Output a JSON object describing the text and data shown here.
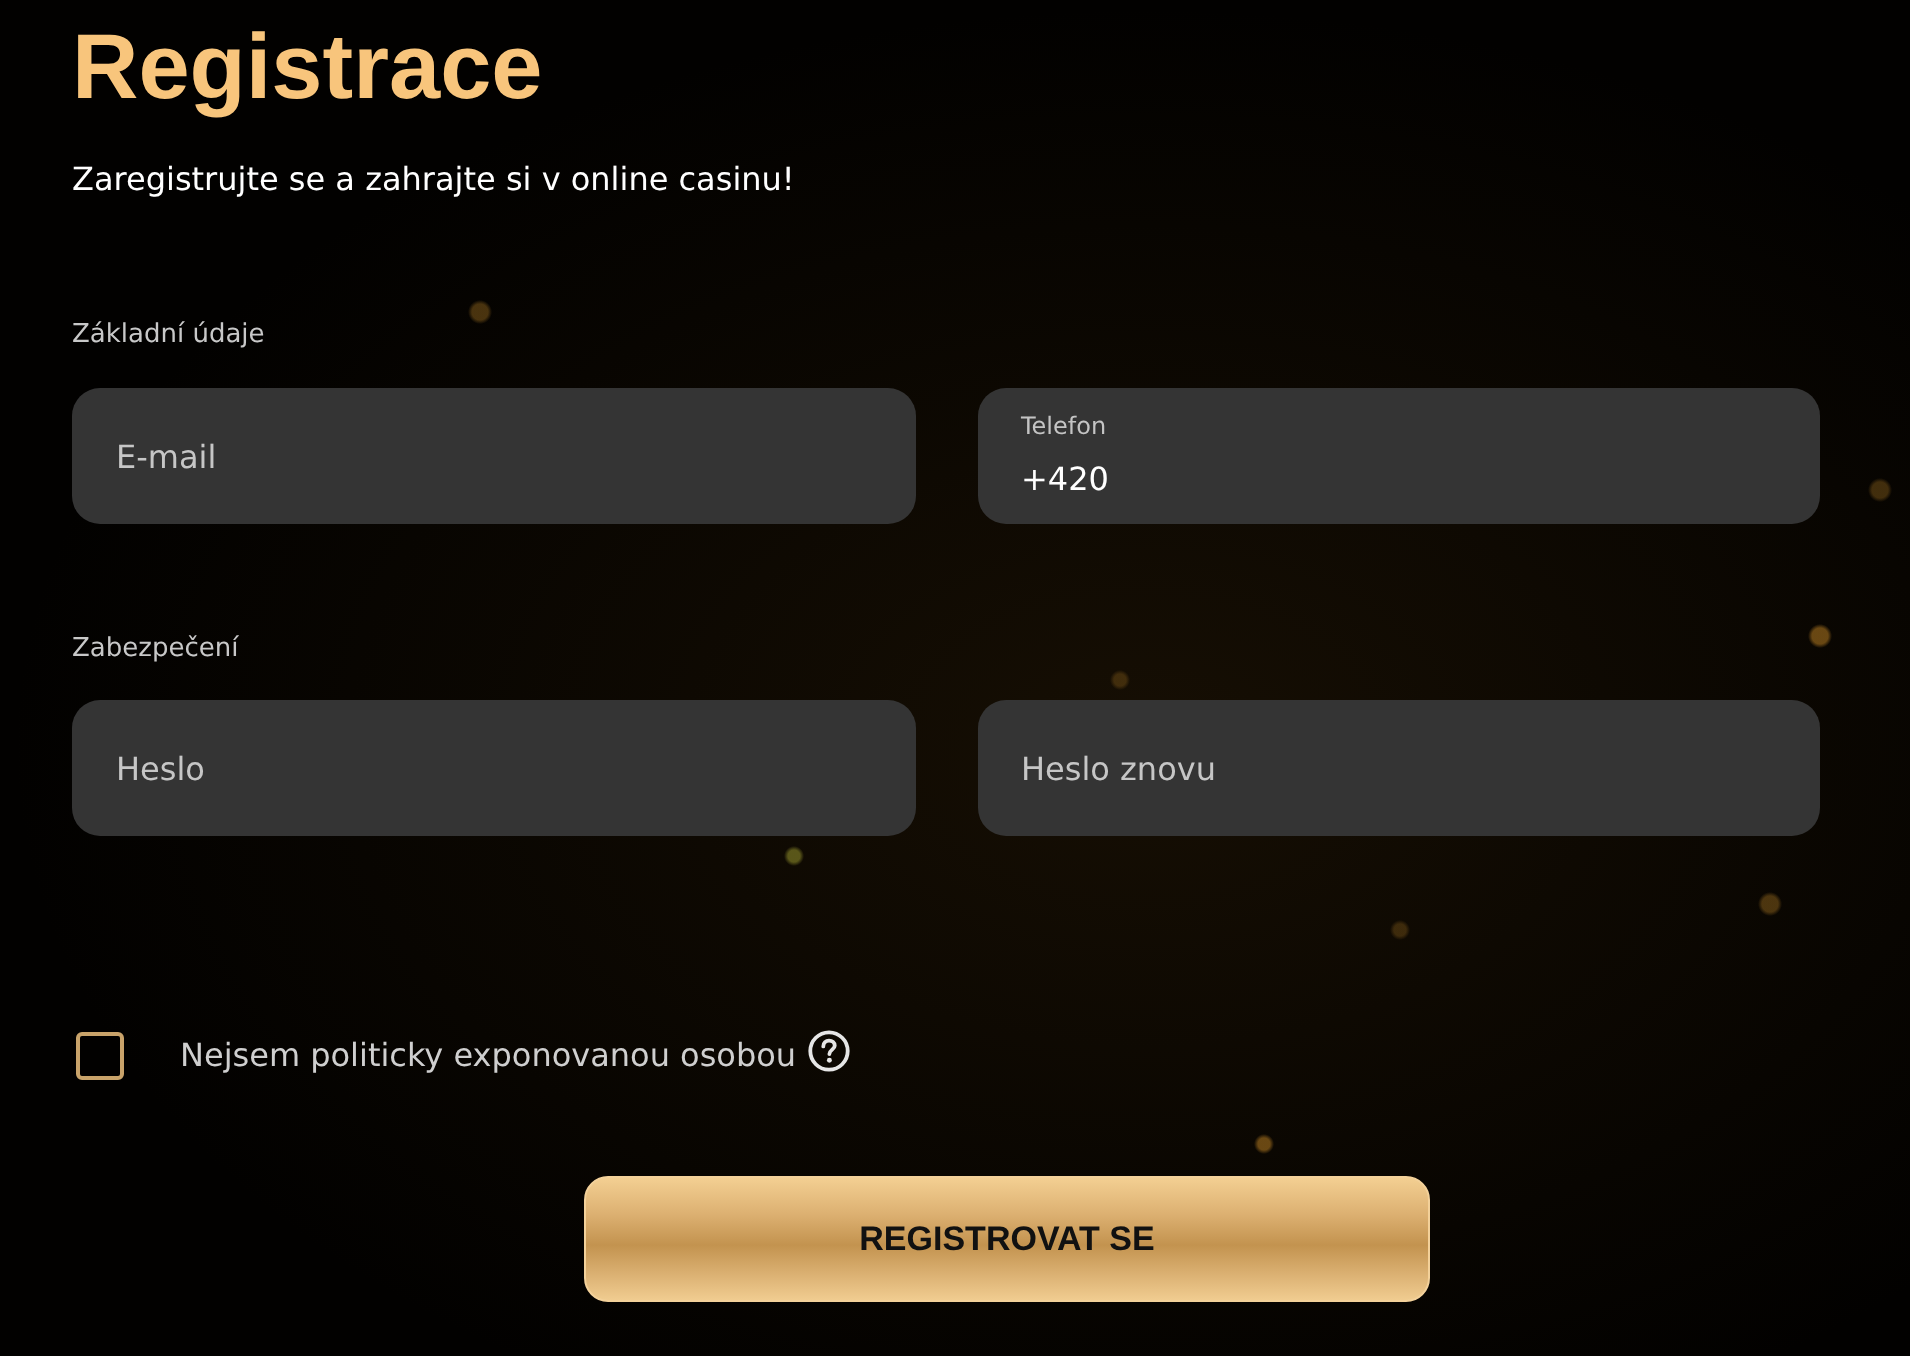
{
  "title": "Registrace",
  "subtitle": "Zaregistrujte se a zahrajte si v online casinu!",
  "sections": [
    {
      "label": "Základní údaje",
      "fields": [
        {
          "kind": "placeholder",
          "placeholder": "E-mail"
        },
        {
          "kind": "labeled",
          "label": "Telefon",
          "value": "+420"
        }
      ]
    },
    {
      "label": "Zabezpečení",
      "fields": [
        {
          "kind": "placeholder",
          "placeholder": "Heslo"
        },
        {
          "kind": "placeholder",
          "placeholder": "Heslo znovu"
        }
      ]
    }
  ],
  "consent": {
    "label": "Nejsem politicky exponovanou osobou",
    "checked": false
  },
  "submit": {
    "label": "REGISTROVAT SE"
  }
}
